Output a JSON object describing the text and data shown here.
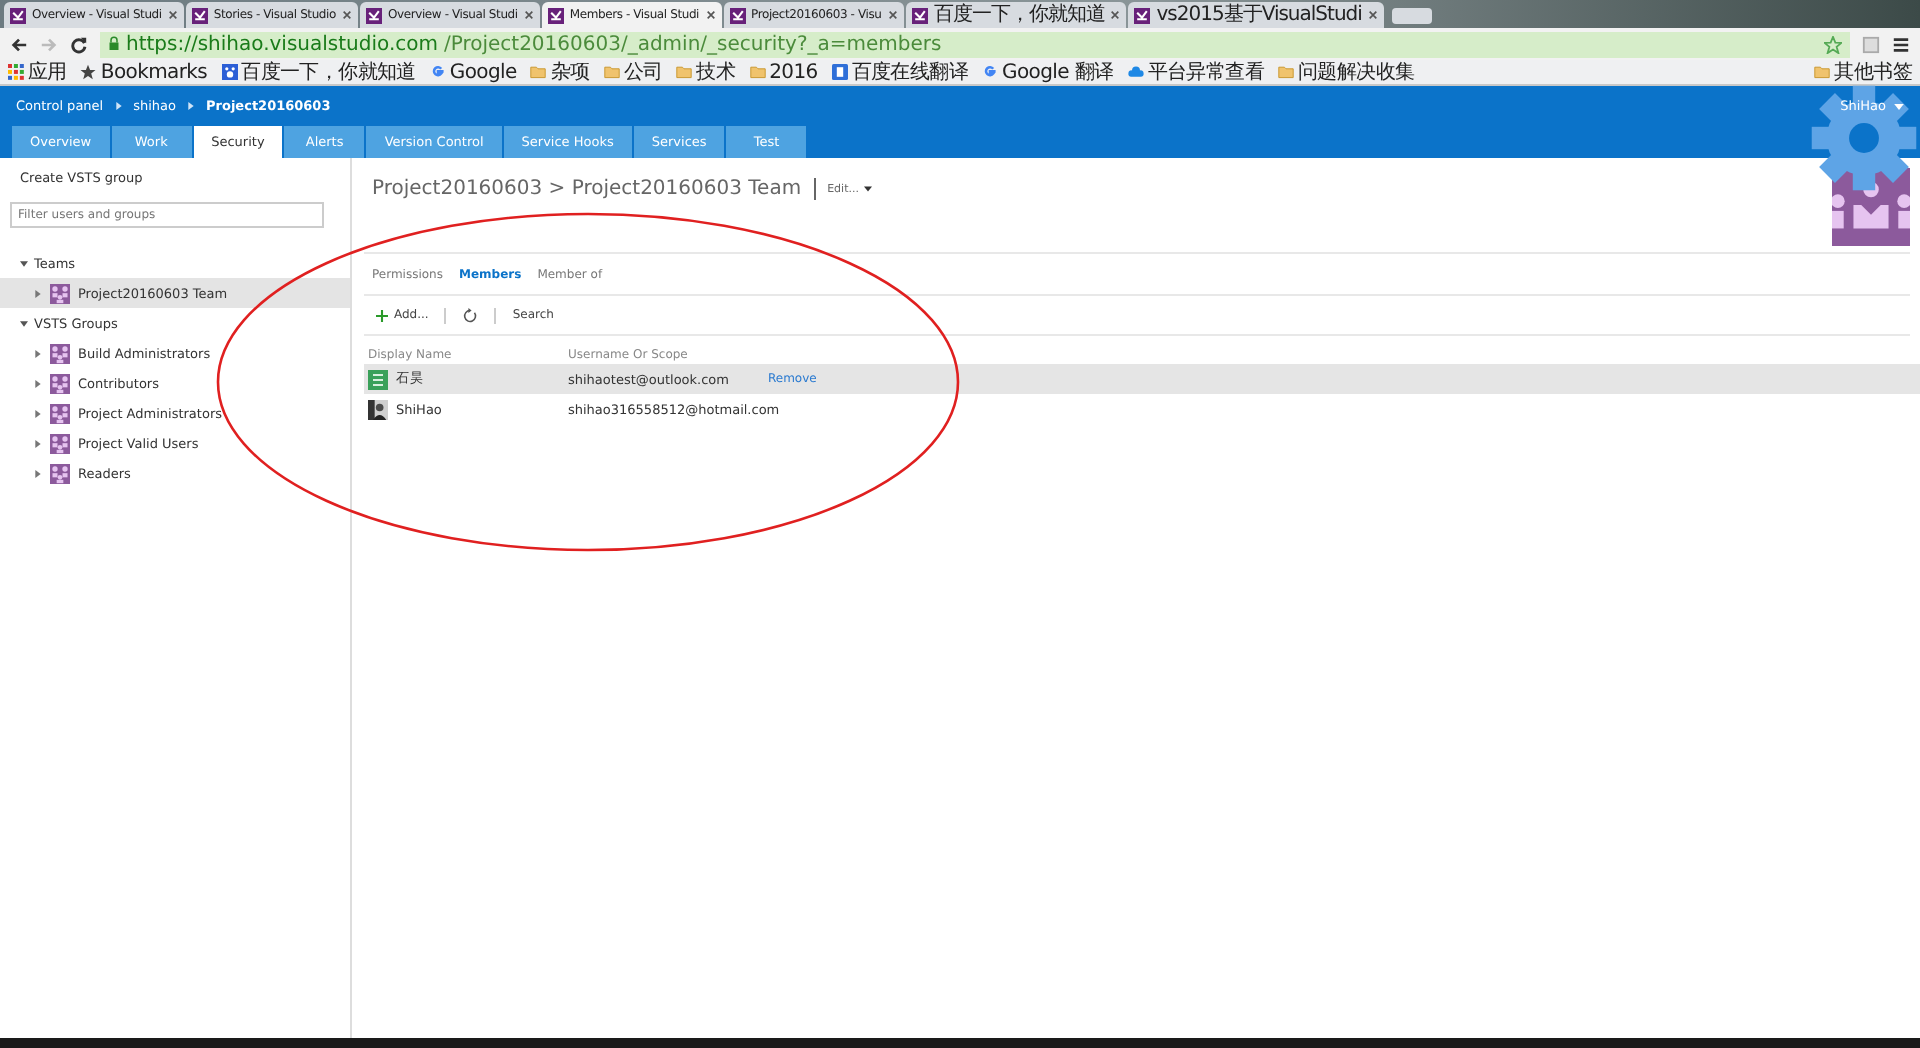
{
  "browser": {
    "tabs": [
      {
        "title": "Overview - Visual Studi",
        "selected": false
      },
      {
        "title": "Stories - Visual Studio",
        "selected": false
      },
      {
        "title": "Overview - Visual Studi",
        "selected": false
      },
      {
        "title": "Members - Visual Studi",
        "selected": true
      },
      {
        "title": "Project20160603 - Visu",
        "selected": false
      },
      {
        "title": "百度一下，你就知道",
        "selected": false
      },
      {
        "title": "vs2015基于VisualStudi",
        "selected": false
      }
    ],
    "url_host": "https://shihao.visualstudio.com",
    "url_path": "/Project20160603/_admin/_security?_a=members",
    "bookmarks": [
      {
        "label": "应用",
        "kind": "apps"
      },
      {
        "label": "Bookmarks",
        "kind": "star"
      },
      {
        "label": "百度一下，你就知道",
        "kind": "paw"
      },
      {
        "label": "Google",
        "kind": "google"
      },
      {
        "label": "杂项",
        "kind": "folder"
      },
      {
        "label": "公司",
        "kind": "folder"
      },
      {
        "label": "技术",
        "kind": "folder"
      },
      {
        "label": "2016",
        "kind": "folder"
      },
      {
        "label": "百度在线翻译",
        "kind": "translate"
      },
      {
        "label": "Google 翻译",
        "kind": "google"
      },
      {
        "label": "平台异常查看",
        "kind": "cloud"
      },
      {
        "label": "问题解决收集",
        "kind": "folder"
      }
    ],
    "other_bookmarks": "其他书签"
  },
  "header": {
    "breadcrumb": [
      "Control panel",
      "shihao",
      "Project20160603"
    ],
    "user": "ShiHao",
    "tabs": [
      {
        "label": "Overview",
        "selected": false
      },
      {
        "label": "Work",
        "selected": false
      },
      {
        "label": "Security",
        "selected": true
      },
      {
        "label": "Alerts",
        "selected": false
      },
      {
        "label": "Version Control",
        "selected": false
      },
      {
        "label": "Service Hooks",
        "selected": false
      },
      {
        "label": "Services",
        "selected": false
      },
      {
        "label": "Test",
        "selected": false
      }
    ]
  },
  "sidebar": {
    "create": "Create VSTS group",
    "filter_placeholder": "Filter users and groups",
    "sections": [
      {
        "title": "Teams",
        "expanded": true,
        "items": [
          {
            "label": "Project20160603 Team",
            "selected": true
          }
        ]
      },
      {
        "title": "VSTS Groups",
        "expanded": true,
        "items": [
          {
            "label": "Build Administrators",
            "selected": false
          },
          {
            "label": "Contributors",
            "selected": false
          },
          {
            "label": "Project Administrators",
            "selected": false
          },
          {
            "label": "Project Valid Users",
            "selected": false
          },
          {
            "label": "Readers",
            "selected": false
          }
        ]
      }
    ]
  },
  "main": {
    "title": "Project20160603 > Project20160603 Team",
    "edit": "Edit...",
    "tabs": [
      {
        "label": "Permissions",
        "selected": false
      },
      {
        "label": "Members",
        "selected": true
      },
      {
        "label": "Member of",
        "selected": false
      }
    ],
    "toolbar": {
      "add": "Add...",
      "search": "Search"
    },
    "columns": [
      "Display Name",
      "Username Or Scope"
    ],
    "rows": [
      {
        "name": "石昊",
        "username": "shihaotest@outlook.com",
        "action": "Remove",
        "selected": true,
        "kind": "generic"
      },
      {
        "name": "ShiHao",
        "username": "shihao316558512@hotmail.com",
        "selected": false
      }
    ]
  }
}
